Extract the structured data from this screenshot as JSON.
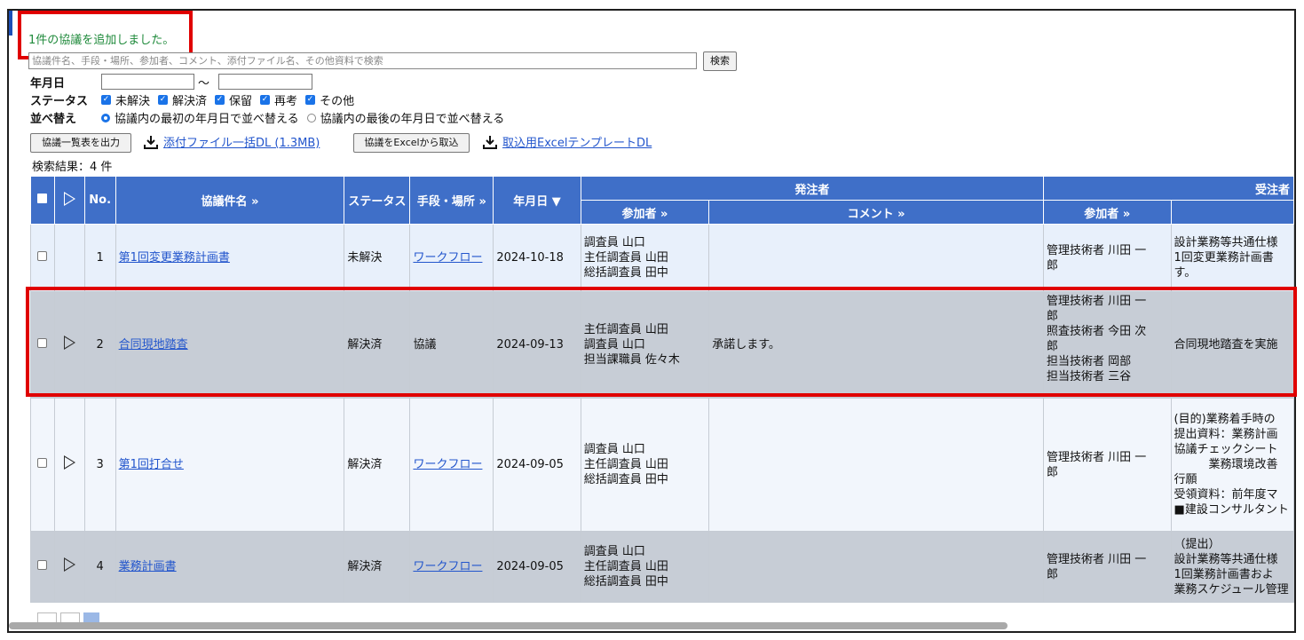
{
  "notice": "1件の協議を追加しました。",
  "search": {
    "placeholder": "協議件名、手段・場所、参加者、コメント、添付ファイル名、その他資料で検索",
    "button": "検索"
  },
  "filters": {
    "date_label": "年月日",
    "date_from": "",
    "date_to": "",
    "tilde": "～",
    "status_label": "ステータス",
    "status_options": [
      "未解決",
      "解決済",
      "保留",
      "再考",
      "その他"
    ],
    "sort_label": "並べ替え",
    "sort_options": [
      "協議内の最初の年月日で並べ替える",
      "協議内の最後の年月日で並べ替える"
    ]
  },
  "actions": {
    "export_list": "協議一覧表を出力",
    "bulk_dl": "添付ファイル一括DL (1.3MB)",
    "import_excel": "協議をExcelから取込",
    "template_dl": "取込用ExcelテンプレートDL"
  },
  "result_count": "検索結果：4 件",
  "table": {
    "headers": {
      "no": "No.",
      "title": "協議件名",
      "status": "ステータス",
      "place": "手段・場所",
      "date": "年月日 ▼",
      "client": "発注者",
      "client_participants": "参加者",
      "client_comment": "コメント",
      "contractor": "受注者",
      "contractor_participants": "参加者",
      "more": "»"
    },
    "rows": [
      {
        "no": "1",
        "title": "第1回変更業務計画書",
        "status": "未解決",
        "place": "ワークフロー",
        "place_link": true,
        "date": "2024-10-18",
        "client_participants": "調査員 山口\n主任調査員 山田\n総括調査員 田中",
        "client_comment": "",
        "contractor_participants": "管理技術者 川田 一\n郎",
        "contractor_comment": "設計業務等共通仕様\n1回変更業務計画書\nす。"
      },
      {
        "no": "2",
        "title": "合同現地踏査",
        "status": "解決済",
        "place": "協議",
        "place_link": false,
        "date": "2024-09-13",
        "client_participants": "主任調査員 山田\n調査員 山口\n担当課職員 佐々木",
        "client_comment": "承諾します。",
        "contractor_participants": "管理技術者 川田 一\n郎\n照査技術者 今田 次\n郎\n担当技術者 岡部\n担当技術者 三谷",
        "contractor_comment": "合同現地踏査を実施"
      },
      {
        "no": "3",
        "title": "第1回打合せ",
        "status": "解決済",
        "place": "ワークフロー",
        "place_link": true,
        "date": "2024-09-05",
        "client_participants": "調査員 山口\n主任調査員 山田\n総括調査員 田中",
        "client_comment": "",
        "contractor_participants": "管理技術者 川田 一\n郎",
        "contractor_comment": "(目的)業務着手時の\n提出資料：業務計画\n協議チェックシート\n　　　業務環境改善\n行願\n受領資料：前年度マ\n■建設コンサルタント"
      },
      {
        "no": "4",
        "title": "業務計画書",
        "status": "解決済",
        "place": "ワークフロー",
        "place_link": true,
        "date": "2024-09-05",
        "client_participants": "調査員 山口\n主任調査員 山田\n総括調査員 田中",
        "client_comment": "",
        "contractor_participants": "管理技術者 川田 一\n郎",
        "contractor_comment": "（提出）\n設計業務等共通仕様\n1回業務計画書およ\n業務スケジュール管理"
      }
    ]
  }
}
